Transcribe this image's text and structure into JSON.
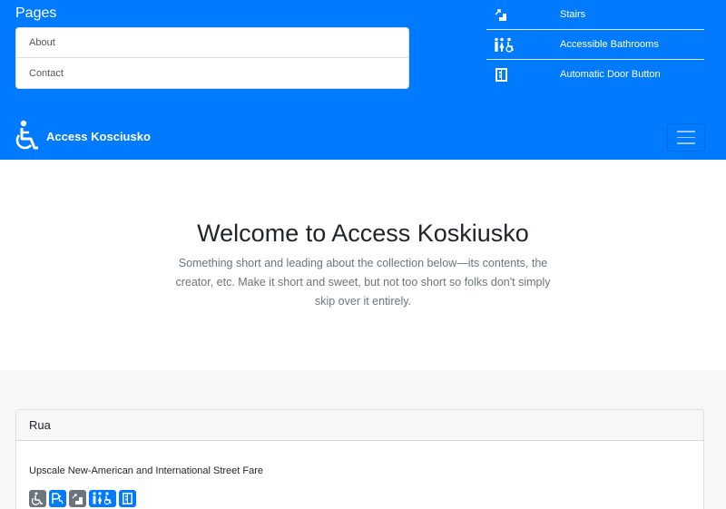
{
  "pages": {
    "title": "Pages",
    "items": [
      {
        "label": "About"
      },
      {
        "label": "Contact"
      }
    ]
  },
  "legend": {
    "items": [
      {
        "icon": "stairs-icon",
        "label": "Stairs"
      },
      {
        "icon": "accessible-bathroom-icon",
        "label": "Accessible Bathrooms"
      },
      {
        "icon": "automatic-door-icon",
        "label": "Automatic Door Button"
      }
    ]
  },
  "navbar": {
    "brand": "Access Kosciusko",
    "brand_icon": "wheelchair-icon",
    "toggler_icon": "hamburger-menu-icon"
  },
  "hero": {
    "title": "Welcome to Access Koskiusko",
    "lead": "Something short and leading about the collection below—its contents, the creator, etc. Make it short and sweet, but not too short so folks don't simply skip over it entirely."
  },
  "listing": {
    "name": "Rua",
    "description": "Upscale New-American and International Street Fare",
    "features": [
      {
        "icon": "wheelchair-icon",
        "color": "#6c757d"
      },
      {
        "icon": "accessible-parking-icon",
        "color": "#007bff"
      },
      {
        "icon": "stairs-icon",
        "color": "#6c757d"
      },
      {
        "icon": "accessible-bathroom-icon",
        "color": "#007bff"
      },
      {
        "icon": "automatic-door-icon",
        "color": "#007bff"
      }
    ]
  },
  "colors": {
    "primary": "#007bff",
    "secondary": "#6c757d",
    "muted_text": "#6c757d",
    "section_bg": "#f7f7f7"
  }
}
